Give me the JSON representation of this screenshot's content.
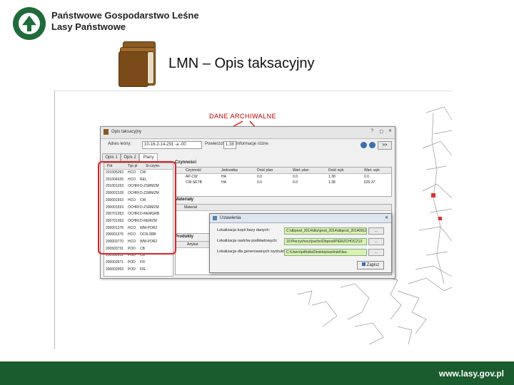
{
  "header": {
    "org_line1": "Państwowe Gospodarstwo Leśne",
    "org_line2": "Lasy Państwowe",
    "title": "LMN – Opis taksacyjny"
  },
  "annotation": {
    "label": "DANE ARCHIWALNE"
  },
  "window": {
    "title": "Opis taksacyjny",
    "address_label": "Adres leśny:",
    "address_value": "10-16-2-14-291 -a -00",
    "forest_label": "Powierzchnia:",
    "forest_value": "1.38",
    "info_label": "Informacje różne",
    "tabs": [
      "Opis 1",
      "Opis 2",
      "Plany"
    ],
    "left_table": {
      "headers": [
        "Pot",
        "Typ pl",
        "Sr.czynn."
      ],
      "rows": [
        [
          "201005263",
          "HCO",
          "CW"
        ],
        [
          "201004325",
          "HCO",
          "REL"
        ],
        [
          "201001263",
          "OCHRI",
          "D-ZSRMZM"
        ],
        [
          "200001328",
          "OCHRI",
          "D-ZSRMZM"
        ],
        [
          "200001553",
          "HCO",
          "CW"
        ],
        [
          "200001553",
          "OCHRI",
          "D-ZSRMZM"
        ],
        [
          "200701363",
          "OCHRI",
          "D-REMGRB"
        ],
        [
          "200701363",
          "OCHRI",
          "D-REMZM"
        ],
        [
          "200001376",
          "HCO",
          "WM-POR2"
        ],
        [
          "200001376",
          "HCO",
          "OCN-3RB"
        ],
        [
          "200003770",
          "HCO",
          "WM-POR2"
        ],
        [
          "200503731",
          "POD",
          "CB"
        ],
        [
          "200502811",
          "POD",
          "CB"
        ],
        [
          "200002971",
          "POD",
          "FIF"
        ],
        [
          "200002953",
          "POD",
          "FIE"
        ]
      ]
    },
    "sections": {
      "activities": "Czynności",
      "materials": "Materiały",
      "products": "Produkty"
    },
    "activities_table": {
      "headers": [
        "Czynność",
        "Jednostka",
        "Dość plan",
        "Wart. plan",
        "Dość wyk",
        "Wart. wyk"
      ],
      "rows": [
        [
          "AP-CW",
          "HA",
          "0.0",
          "0.0",
          "1.38",
          "0.0"
        ],
        [
          "CW-SETB",
          "HA",
          "0.0",
          "0.0",
          "1.38",
          "625.37"
        ]
      ]
    },
    "materials_header": "Materiał",
    "products_header": "Artykuł"
  },
  "dialog": {
    "title": "Ustawienia",
    "rows": [
      {
        "label": "Lokalizacja kopii bazy danych:",
        "value": "C:\\dbprod_2014\\dbz\\prod_2014\\dbprod_20140912",
        "button": "..."
      },
      {
        "label": "Lokalizacja rastrów podkładowych:",
        "value": "10:Pierzychocz\\pachn\\Dbprod\\PIERZCHOCZ13",
        "button": "..."
      },
      {
        "label": "Lokalizacja dla generowanych wydruków:",
        "value": "C:\\Users\\pdfukla\\Desktop\\wydruki\\\\lao.",
        "button": "..."
      }
    ],
    "save": "Zapisz"
  },
  "footer": {
    "url": "www.lasy.gov.pl"
  }
}
